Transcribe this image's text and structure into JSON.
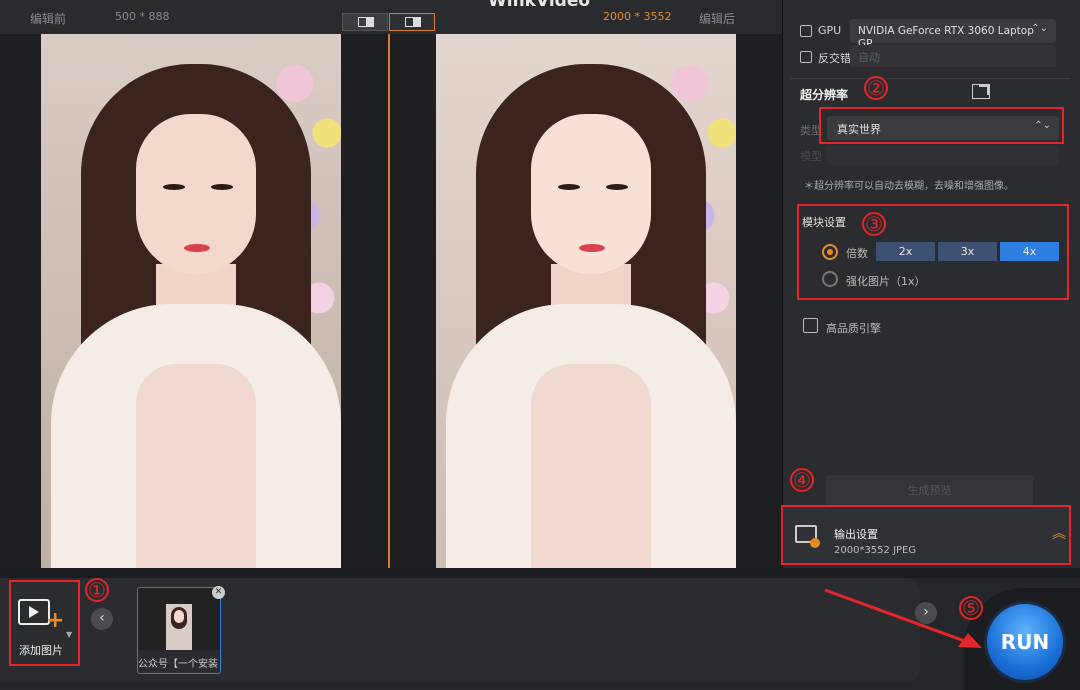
{
  "app": {
    "title": "WinkVideo"
  },
  "preview": {
    "before_label": "编辑前",
    "before_dims": "500 * 888",
    "after_dims": "2000 * 3552",
    "after_label": "编辑后"
  },
  "panel": {
    "gpu_label": "GPU",
    "gpu_value": "NVIDIA GeForce RTX 3060 Laptop GP",
    "antialias_label": "反交错",
    "antialias_value": "自动",
    "super_res_title": "超分辨率",
    "type_label": "类型",
    "type_value": "真实世界",
    "model_label": "模型",
    "hint": "＊超分辨率可以自动去模糊，去噪和增强图像。",
    "module_title": "模块设置",
    "scale_label": "倍数",
    "scale_options": [
      "2x",
      "3x",
      "4x"
    ],
    "scale_selected": "4x",
    "enhance_label": "强化图片（1x）",
    "hq_label": "高品质引擎",
    "preview_button": "生成预览",
    "output_title": "输出设置",
    "output_value": "2000*3552  JPEG"
  },
  "bottom": {
    "add_label": "添加图片",
    "thumb_caption": "公众号【一个安装",
    "run_label": "RUN"
  },
  "markers": [
    "①",
    "②",
    "③",
    "④",
    "⑤"
  ],
  "colors": {
    "accent": "#e58b2a",
    "annotation": "#e4252a",
    "selected_scale": "#2e7de0"
  }
}
